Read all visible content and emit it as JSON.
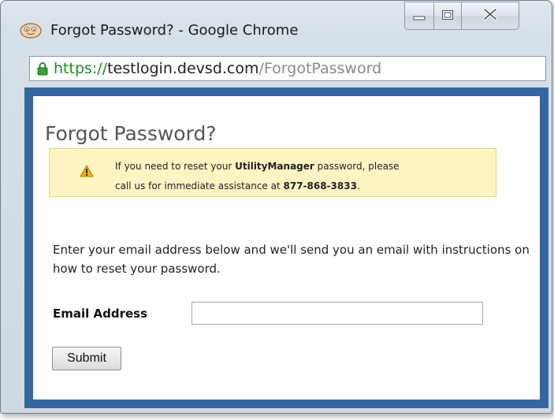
{
  "window": {
    "title": "Forgot Password? - Google Chrome",
    "controls": {
      "minimize": "minimize-icon",
      "maximize": "maximize-icon",
      "close": "close-icon"
    }
  },
  "address_bar": {
    "scheme": "https://",
    "host": "testlogin.devsd.com",
    "path": "/ForgotPassword",
    "secure_icon": "lock-icon"
  },
  "page": {
    "title": "Forgot Password?",
    "notice": {
      "icon": "warning-icon",
      "line1_prefix": "If you need to reset your ",
      "line1_bold": "UtilityManager",
      "line1_suffix": " password, please",
      "line2_prefix": "call us for immediate assistance at ",
      "line2_bold": "877-868-3833",
      "line2_suffix": "."
    },
    "instructions": "Enter your email address below and we'll send you an email with instructions on how to reset your password.",
    "email_label": "Email Address",
    "email_value": "",
    "submit_label": "Submit"
  },
  "colors": {
    "frame_blue": "#3666a0",
    "notice_bg": "#fdf4c4",
    "notice_border": "#ead48a",
    "secure_green": "#1f8a2a"
  }
}
